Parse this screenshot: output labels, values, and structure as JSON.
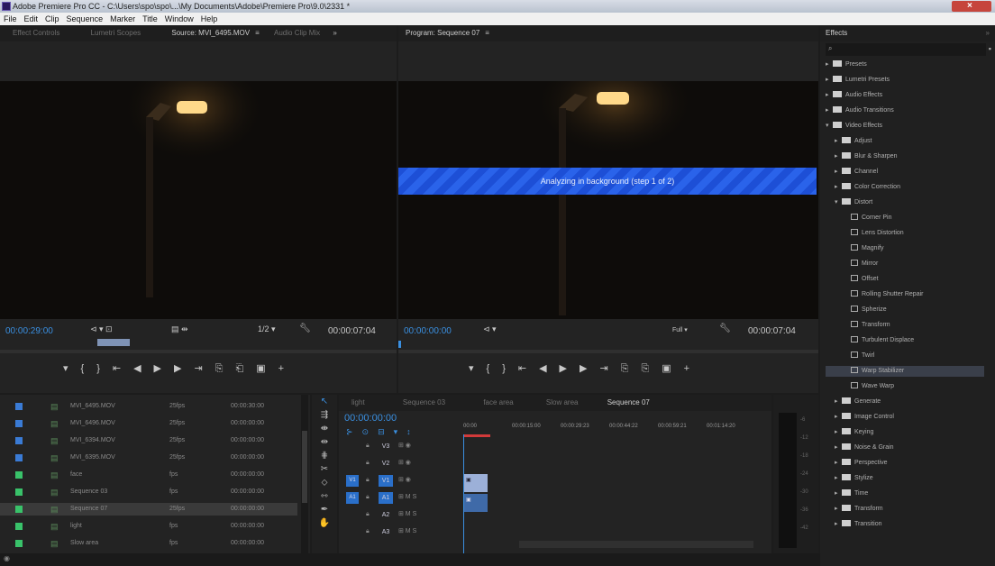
{
  "window": {
    "title": "Adobe Premiere Pro CC - C:\\Users\\spo\\spo\\...\\My Documents\\Adobe\\Premiere Pro\\9.0\\2331 *"
  },
  "menu": [
    "File",
    "Edit",
    "Clip",
    "Sequence",
    "Marker",
    "Title",
    "Window",
    "Help"
  ],
  "source_panel": {
    "tabs": [
      "Effect Controls",
      "Lumetri Scopes",
      "Source: MVI_6495.MOV",
      "Audio Clip Mix"
    ],
    "active_tab": 2,
    "timecode_in": "00:00:29:00",
    "timecode_out": "00:00:07:04"
  },
  "program_panel": {
    "tab": "Program: Sequence 07",
    "timecode_in": "00:00:00:00",
    "zoom": "Full",
    "timecode_out": "00:00:07:04",
    "overlay": "Analyzing in background (step 1 of 2)"
  },
  "project": {
    "rows": [
      {
        "name": "MVI_6495.MOV",
        "fps": "25fps",
        "dur": "00:00:30:00",
        "color": "#3a7bd5"
      },
      {
        "name": "MVI_6496.MOV",
        "fps": "25fps",
        "dur": "00:00:00:00",
        "color": "#3a7bd5"
      },
      {
        "name": "MVI_6394.MOV",
        "fps": "25fps",
        "dur": "00:00:00:00",
        "color": "#3a7bd5"
      },
      {
        "name": "MVI_6395.MOV",
        "fps": "25fps",
        "dur": "00:00:00:00",
        "color": "#3a7bd5"
      },
      {
        "name": "face",
        "fps": "fps",
        "dur": "00:00:00:00",
        "color": "#39c26a"
      },
      {
        "name": "Sequence 03",
        "fps": "fps",
        "dur": "00:00:00:00",
        "color": "#39c26a"
      },
      {
        "name": "Sequence 07",
        "fps": "25fps",
        "dur": "00:00:00:00",
        "color": "#39c26a"
      },
      {
        "name": "light",
        "fps": "fps",
        "dur": "00:00:00:00",
        "color": "#39c26a"
      },
      {
        "name": "Slow area",
        "fps": "fps",
        "dur": "00:00:00:00",
        "color": "#39c26a"
      }
    ]
  },
  "timeline": {
    "tabs": [
      "light",
      "Sequence 03",
      "face area",
      "Slow area",
      "Sequence 07"
    ],
    "active_tab": 4,
    "timecode": "00:00:00:00",
    "ruler": [
      "00:00",
      "00:00:15:00",
      "00:00:29:23",
      "00:00:44:22",
      "00:00:59:21",
      "00:01:14:20"
    ],
    "tracks": [
      "V3",
      "V2",
      "V1",
      "A1",
      "A2",
      "A3"
    ]
  },
  "effects": {
    "title": "Effects",
    "items": [
      {
        "label": "Presets",
        "kind": "folder",
        "indent": 0,
        "open": false
      },
      {
        "label": "Lumetri Presets",
        "kind": "folder",
        "indent": 0,
        "open": false
      },
      {
        "label": "Audio Effects",
        "kind": "folder",
        "indent": 0,
        "open": false
      },
      {
        "label": "Audio Transitions",
        "kind": "folder",
        "indent": 0,
        "open": false
      },
      {
        "label": "Video Effects",
        "kind": "folder",
        "indent": 0,
        "open": true
      },
      {
        "label": "Adjust",
        "kind": "folder",
        "indent": 1,
        "open": false
      },
      {
        "label": "Blur & Sharpen",
        "kind": "folder",
        "indent": 1,
        "open": false
      },
      {
        "label": "Channel",
        "kind": "folder",
        "indent": 1,
        "open": false
      },
      {
        "label": "Color Correction",
        "kind": "folder",
        "indent": 1,
        "open": false
      },
      {
        "label": "Distort",
        "kind": "folder",
        "indent": 1,
        "open": true
      },
      {
        "label": "Corner Pin",
        "kind": "fx",
        "indent": 2
      },
      {
        "label": "Lens Distortion",
        "kind": "fx",
        "indent": 2
      },
      {
        "label": "Magnify",
        "kind": "fx",
        "indent": 2
      },
      {
        "label": "Mirror",
        "kind": "fx",
        "indent": 2
      },
      {
        "label": "Offset",
        "kind": "fx",
        "indent": 2
      },
      {
        "label": "Rolling Shutter Repair",
        "kind": "fx",
        "indent": 2
      },
      {
        "label": "Spherize",
        "kind": "fx",
        "indent": 2
      },
      {
        "label": "Transform",
        "kind": "fx",
        "indent": 2
      },
      {
        "label": "Turbulent Displace",
        "kind": "fx",
        "indent": 2
      },
      {
        "label": "Twirl",
        "kind": "fx",
        "indent": 2
      },
      {
        "label": "Warp Stabilizer",
        "kind": "fx",
        "indent": 2,
        "selected": true
      },
      {
        "label": "Wave Warp",
        "kind": "fx",
        "indent": 2
      },
      {
        "label": "Generate",
        "kind": "folder",
        "indent": 1,
        "open": false
      },
      {
        "label": "Image Control",
        "kind": "folder",
        "indent": 1,
        "open": false
      },
      {
        "label": "Keying",
        "kind": "folder",
        "indent": 1,
        "open": false
      },
      {
        "label": "Noise & Grain",
        "kind": "folder",
        "indent": 1,
        "open": false
      },
      {
        "label": "Perspective",
        "kind": "folder",
        "indent": 1,
        "open": false
      },
      {
        "label": "Stylize",
        "kind": "folder",
        "indent": 1,
        "open": false
      },
      {
        "label": "Time",
        "kind": "folder",
        "indent": 1,
        "open": false
      },
      {
        "label": "Transform",
        "kind": "folder",
        "indent": 1,
        "open": false
      },
      {
        "label": "Transition",
        "kind": "folder",
        "indent": 1,
        "open": false
      }
    ]
  },
  "colors": {
    "accent": "#2f8ce8",
    "timecode": "#3a8fe0",
    "overlay_band": "#1d4fd6",
    "clip": "#9cb0d8"
  }
}
